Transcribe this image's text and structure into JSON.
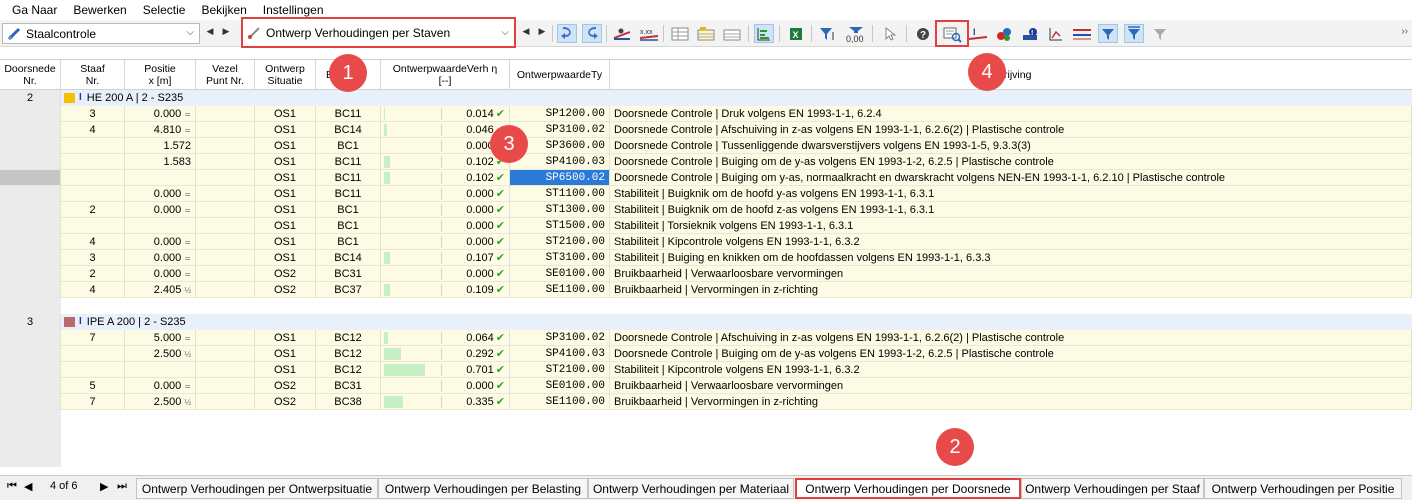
{
  "menu": [
    "Ga Naar",
    "Bewerken",
    "Selectie",
    "Bekijken",
    "Instellingen"
  ],
  "toolbar": {
    "module_combo": "Staalcontrole",
    "result_combo": "Ontwerp Verhoudingen per Staven"
  },
  "columns": {
    "doorsnede": [
      "Doorsnede",
      "Nr."
    ],
    "staaf": [
      "Staaf",
      "Nr."
    ],
    "positie": [
      "Positie",
      "x [m]"
    ],
    "vezel": [
      "Vezel",
      "Punt Nr."
    ],
    "situatie": [
      "Ontwerp",
      "Situatie"
    ],
    "belasting": "B",
    "verhouding": [
      "OntwerpwaardeVerh η",
      "[--]"
    ],
    "type": "OntwerpwaardeTy",
    "beschrijving": "rijving"
  },
  "groups": [
    {
      "nr": "2",
      "label": "HE 200 A | 2 - S235",
      "color": "#f2c200",
      "rows": [
        {
          "staaf": "3",
          "pos": "0.000",
          "sym": "≍",
          "os": "OS1",
          "bc": "BC11",
          "ratio": 0.014,
          "ratio_text": "0.014",
          "type": "SP1200.00",
          "desc": "Doorsnede Controle | Druk volgens EN 1993-1-1, 6.2.4"
        },
        {
          "staaf": "4",
          "pos": "4.810",
          "sym": "≍",
          "os": "OS1",
          "bc": "BC14",
          "ratio": 0.046,
          "ratio_text": "0.046",
          "type": "SP3100.02",
          "desc": "Doorsnede Controle | Afschuiving in z-as volgens EN 1993-1-1, 6.2.6(2) | Plastische controle"
        },
        {
          "staaf": "",
          "pos": "1.572",
          "sym": "",
          "os": "OS1",
          "bc": "BC1",
          "ratio": 0.0,
          "ratio_text": "0.000",
          "type": "SP3600.00",
          "desc": "Doorsnede Controle | Tussenliggende dwarsverstijvers volgens EN 1993-1-5, 9.3.3(3)"
        },
        {
          "staaf": "",
          "pos": "1.583",
          "sym": "",
          "os": "OS1",
          "bc": "BC11",
          "ratio": 0.102,
          "ratio_text": "0.102",
          "type": "SP4100.03",
          "desc": "Doorsnede Controle | Buiging om de y-as volgens EN 1993-1-2, 6.2.5 | Plastische controle"
        },
        {
          "staaf": "",
          "pos": "",
          "sym": "",
          "os": "OS1",
          "bc": "BC11",
          "ratio": 0.102,
          "ratio_text": "0.102",
          "type": "SP6500.02",
          "desc": "Doorsnede Controle | Buiging om y-as, normaalkracht en dwarskracht volgens NEN-EN 1993-1-1, 6.2.10 | Plastische controle",
          "selected": true
        },
        {
          "staaf": "",
          "pos": "0.000",
          "sym": "≍",
          "os": "OS1",
          "bc": "BC11",
          "ratio": 0.0,
          "ratio_text": "0.000",
          "type": "ST1100.00",
          "desc": "Stabiliteit | Buigknik om de hoofd y-as volgens EN 1993-1-1, 6.3.1"
        },
        {
          "staaf": "2",
          "pos": "0.000",
          "sym": "≍",
          "os": "OS1",
          "bc": "BC1",
          "ratio": 0.0,
          "ratio_text": "0.000",
          "type": "ST1300.00",
          "desc": "Stabiliteit | Buigknik om de hoofd z-as volgens EN 1993-1-1, 6.3.1"
        },
        {
          "staaf": "",
          "pos": "",
          "sym": "",
          "os": "OS1",
          "bc": "BC1",
          "ratio": 0.0,
          "ratio_text": "0.000",
          "type": "ST1500.00",
          "desc": "Stabiliteit | Torsieknik volgens EN 1993-1-1, 6.3.1"
        },
        {
          "staaf": "4",
          "pos": "0.000",
          "sym": "≍",
          "os": "OS1",
          "bc": "BC1",
          "ratio": 0.0,
          "ratio_text": "0.000",
          "type": "ST2100.00",
          "desc": "Stabiliteit | Kipcontrole volgens EN 1993-1-1, 6.3.2"
        },
        {
          "staaf": "3",
          "pos": "0.000",
          "sym": "≍",
          "os": "OS1",
          "bc": "BC14",
          "ratio": 0.107,
          "ratio_text": "0.107",
          "type": "ST3100.00",
          "desc": "Stabiliteit | Buiging en knikken om de hoofdassen volgens EN 1993-1-1, 6.3.3"
        },
        {
          "staaf": "2",
          "pos": "0.000",
          "sym": "≍",
          "os": "OS2",
          "bc": "BC31",
          "ratio": 0.0,
          "ratio_text": "0.000",
          "type": "SE0100.00",
          "desc": "Bruikbaarheid | Verwaarloosbare vervormingen"
        },
        {
          "staaf": "4",
          "pos": "2.405",
          "sym": "½",
          "os": "OS2",
          "bc": "BC37",
          "ratio": 0.109,
          "ratio_text": "0.109",
          "type": "SE1100.00",
          "desc": "Bruikbaarheid | Vervormingen in z-richting"
        }
      ]
    },
    {
      "nr": "3",
      "label": "IPE A 200 | 2 - S235",
      "color": "#b96a6a",
      "rows": [
        {
          "staaf": "7",
          "pos": "5.000",
          "sym": "≍",
          "os": "OS1",
          "bc": "BC12",
          "ratio": 0.064,
          "ratio_text": "0.064",
          "type": "SP3100.02",
          "desc": "Doorsnede Controle | Afschuiving in z-as volgens EN 1993-1-1, 6.2.6(2) | Plastische controle"
        },
        {
          "staaf": "",
          "pos": "2.500",
          "sym": "½",
          "os": "OS1",
          "bc": "BC12",
          "ratio": 0.292,
          "ratio_text": "0.292",
          "type": "SP4100.03",
          "desc": "Doorsnede Controle | Buiging om de y-as volgens EN 1993-1-2, 6.2.5 | Plastische controle"
        },
        {
          "staaf": "",
          "pos": "",
          "sym": "",
          "os": "OS1",
          "bc": "BC12",
          "ratio": 0.701,
          "ratio_text": "0.701",
          "type": "ST2100.00",
          "desc": "Stabiliteit | Kipcontrole volgens EN 1993-1-1, 6.3.2"
        },
        {
          "staaf": "5",
          "pos": "0.000",
          "sym": "≍",
          "os": "OS2",
          "bc": "BC31",
          "ratio": 0.0,
          "ratio_text": "0.000",
          "type": "SE0100.00",
          "desc": "Bruikbaarheid | Verwaarloosbare vervormingen"
        },
        {
          "staaf": "7",
          "pos": "2.500",
          "sym": "½",
          "os": "OS2",
          "bc": "BC38",
          "ratio": 0.335,
          "ratio_text": "0.335",
          "type": "SE1100.00",
          "desc": "Bruikbaarheid | Vervormingen in z-richting"
        }
      ]
    }
  ],
  "badges": [
    "1",
    "2",
    "3",
    "4"
  ],
  "pager": {
    "first": "⏮",
    "prev": "◀",
    "text": "4 of 6",
    "next": "▶",
    "last": "⏭"
  },
  "tabs": [
    {
      "label": "Ontwerp Verhoudingen per Ontwerpsituatie",
      "active": false
    },
    {
      "label": "Ontwerp Verhoudingen per Belasting",
      "active": false
    },
    {
      "label": "Ontwerp Verhoudingen per Materiaal",
      "active": false
    },
    {
      "label": "Ontwerp Verhoudingen per Doorsnede",
      "active": true
    },
    {
      "label": "Ontwerp Verhoudingen per Staaf",
      "active": false
    },
    {
      "label": "Ontwerp Verhoudingen per Positie",
      "active": false
    }
  ]
}
